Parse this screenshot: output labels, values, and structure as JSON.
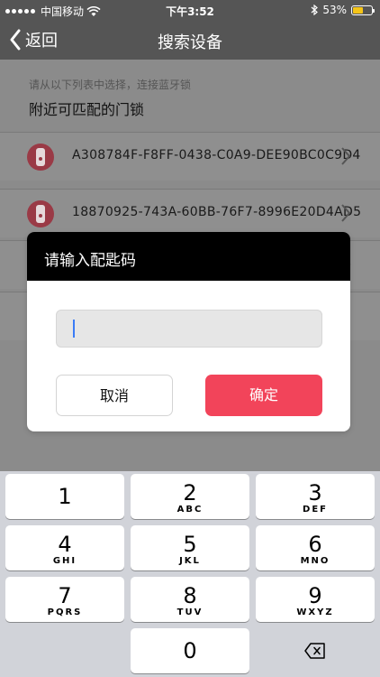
{
  "status_bar": {
    "carrier": "中国移动",
    "time": "下午3:52",
    "battery": "53%",
    "battery_level": 0.53
  },
  "nav": {
    "back_label": "返回",
    "title": "搜索设备"
  },
  "content": {
    "hint": "请从以下列表中选择，连接蓝牙锁",
    "section_title": "附近可匹配的门锁",
    "devices": [
      {
        "uuid": "A308784F-F8FF-0438-C0A9-DEE90BC0C9D4"
      },
      {
        "uuid": "18870925-743A-60BB-76F7-8996E20D4AD5"
      },
      {
        "uuid": ""
      },
      {
        "uuid": ""
      }
    ]
  },
  "dialog": {
    "title": "请输入配匙码",
    "input_value": "",
    "cancel_label": "取消",
    "confirm_label": "确定"
  },
  "keyboard": {
    "keys": [
      {
        "num": "1",
        "letters": ""
      },
      {
        "num": "2",
        "letters": "ABC"
      },
      {
        "num": "3",
        "letters": "DEF"
      },
      {
        "num": "4",
        "letters": "GHI"
      },
      {
        "num": "5",
        "letters": "JKL"
      },
      {
        "num": "6",
        "letters": "MNO"
      },
      {
        "num": "7",
        "letters": "PQRS"
      },
      {
        "num": "8",
        "letters": "TUV"
      },
      {
        "num": "9",
        "letters": "WXYZ"
      },
      {
        "num": "0",
        "letters": ""
      }
    ]
  },
  "colors": {
    "navbar": "#555555",
    "confirm_button": "#f2445a",
    "lock_icon": "#e26a7a"
  }
}
